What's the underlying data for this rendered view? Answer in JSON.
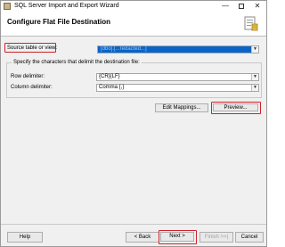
{
  "window": {
    "title": "SQL Server Import and Export Wizard",
    "minimize_glyph": "—",
    "close_glyph": "✕"
  },
  "header": {
    "page_title": "Configure Flat File Destination",
    "icon": "wizard-page-icon"
  },
  "source": {
    "label": "Source table or view:",
    "selected_value": "[dbo].[...redacted...]"
  },
  "delimiters": {
    "group_title": "Specify the characters that delimit the destination file:",
    "row_label": "Row delimiter:",
    "row_value": "{CR}{LF}",
    "column_label": "Column delimiter:",
    "column_value": "Comma {,}"
  },
  "actions": {
    "edit_mappings": "Edit Mappings...",
    "preview": "Preview..."
  },
  "footer": {
    "help": "Help",
    "back": "< Back",
    "next": "Next >",
    "finish": "Finish >>|",
    "cancel": "Cancel"
  },
  "colors": {
    "highlight_red": "#d0202a",
    "selection_blue": "#0a64c8"
  }
}
